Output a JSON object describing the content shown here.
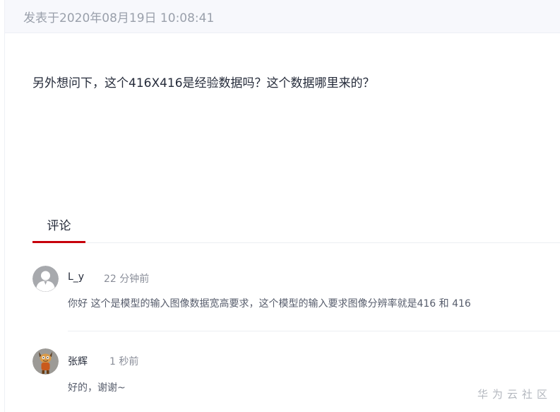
{
  "post": {
    "date": "发表于2020年08月19日 10:08:41",
    "body": "另外想问下，这个416X416是经验数据吗？这个数据哪里来的？"
  },
  "tabs": {
    "comments_label": "评论"
  },
  "comments": [
    {
      "author": "L_y",
      "time": "22 分钟前",
      "text": "你好 这个是模型的输入图像数据宽高要求，这个模型的输入要求图像分辨率就是416 和 416",
      "avatar": "default-user-icon"
    },
    {
      "author": "张辉",
      "time": "1 秒前",
      "text": "好的，谢谢~",
      "avatar": "cartoon-character-avatar"
    }
  ],
  "watermark": "华为云社区",
  "colors": {
    "accent": "#c7000b",
    "primary_text": "#252b3a",
    "secondary_text": "#8a8e99"
  }
}
